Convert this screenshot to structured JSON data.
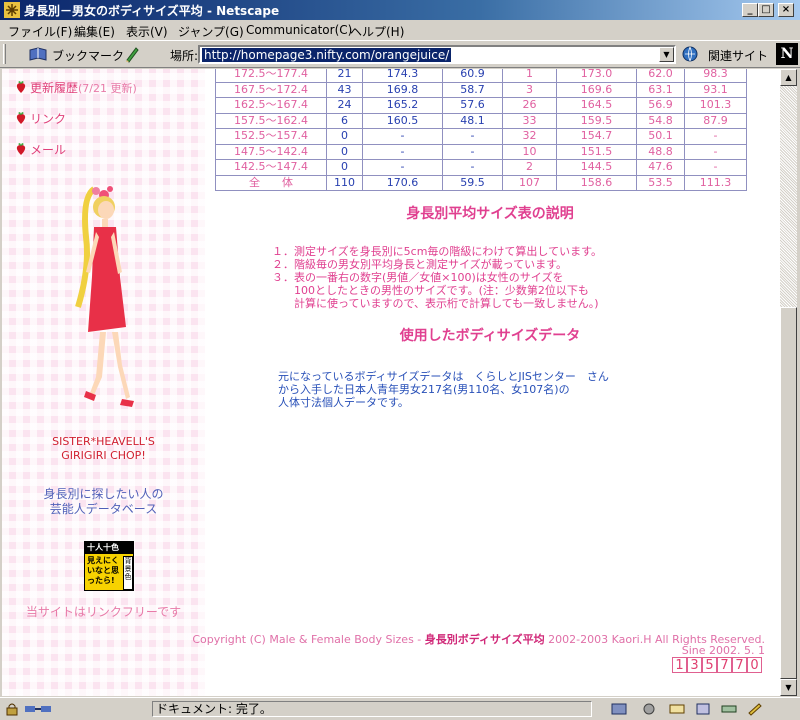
{
  "window": {
    "title": "身長別－男女のボディサイズ平均 - Netscape",
    "min": "_",
    "max": "□",
    "close": "×"
  },
  "menu": {
    "items": [
      "ファイル(F)",
      "編集(E)",
      "表示(V)",
      "ジャンプ(G)",
      "Communicator(C)",
      "ヘルプ(H)"
    ]
  },
  "toolbar": {
    "bookmarks_label": "ブックマーク",
    "location_label": "場所:",
    "url": "http://homepage3.nifty.com/orangejuice/",
    "related_label": "関連サイト",
    "logo": "N"
  },
  "sidebar": {
    "links": [
      {
        "label": "更新履歴",
        "note": "(7/21 更新)"
      },
      {
        "label": "リンク",
        "note": ""
      },
      {
        "label": "メール",
        "note": ""
      }
    ],
    "caption_line1": "SISTER*HEAVELL'S",
    "caption_line2": "GIRIGIRI CHOP!",
    "celeb_line1": "身長別に探したい人の",
    "celeb_line2": "芸能人データベース",
    "badge_top": "十人十色",
    "badge_main": "見えにくいなと思ったら!",
    "badge_side": "背景色",
    "link_free": "当サイトはリンクフリーです"
  },
  "table": {
    "rows": [
      [
        "172.5～177.4",
        "21",
        "174.3",
        "60.9",
        "1",
        "173.0",
        "62.0",
        "98.3"
      ],
      [
        "167.5～172.4",
        "43",
        "169.8",
        "58.7",
        "3",
        "169.6",
        "63.1",
        "93.1"
      ],
      [
        "162.5～167.4",
        "24",
        "165.2",
        "57.6",
        "26",
        "164.5",
        "56.9",
        "101.3"
      ],
      [
        "157.5～162.4",
        "6",
        "160.5",
        "48.1",
        "33",
        "159.5",
        "54.8",
        "87.9"
      ],
      [
        "152.5～157.4",
        "0",
        "-",
        "-",
        "32",
        "154.7",
        "50.1",
        "-"
      ],
      [
        "147.5～142.4",
        "0",
        "-",
        "-",
        "10",
        "151.5",
        "48.8",
        "-"
      ],
      [
        "142.5～147.4",
        "0",
        "-",
        "-",
        "2",
        "144.5",
        "47.6",
        "-"
      ],
      [
        "全　　体",
        "110",
        "170.6",
        "59.5",
        "107",
        "158.6",
        "53.5",
        "111.3"
      ]
    ]
  },
  "explanation": {
    "heading": "身長別平均サイズ表の説明",
    "items": [
      "１．測定サイズを身長別に5cm毎の階級にわけて算出しています。",
      "２．階級毎の男女別平均身長と測定サイズが載っています。",
      "３．表の一番右の数字(男値／女値×100)は女性のサイズを",
      "100としたときの男性のサイズです。(注：少数第2位以下も",
      "計算に使っていますので、表示桁で計算しても一致しません。)"
    ]
  },
  "dataset": {
    "heading": "使用したボディサイズデータ",
    "lines": [
      "元になっているボディサイズデータは　くらしとJISセンター　さん",
      "から入手した日本人青年男女217名(男110名、女107名)の",
      "人体寸法個人データです。"
    ]
  },
  "footer": {
    "copyright_pre": "Copyright (C) Male & Female Body Sizes - ",
    "copyright_site": "身長別ボディサイズ平均",
    "copyright_post": " 2002-2003 Kaori.H All Rights Reserved.",
    "since": "Sine 2002. 5. 1",
    "counter": [
      "1",
      "3",
      "5",
      "7",
      "7",
      "0"
    ]
  },
  "status": {
    "text": "ドキュメント: 完了。"
  },
  "colors": {
    "pink_text": "#e04090",
    "blue_text": "#2840b0",
    "sidebar_bg": "#fbe4f0"
  }
}
